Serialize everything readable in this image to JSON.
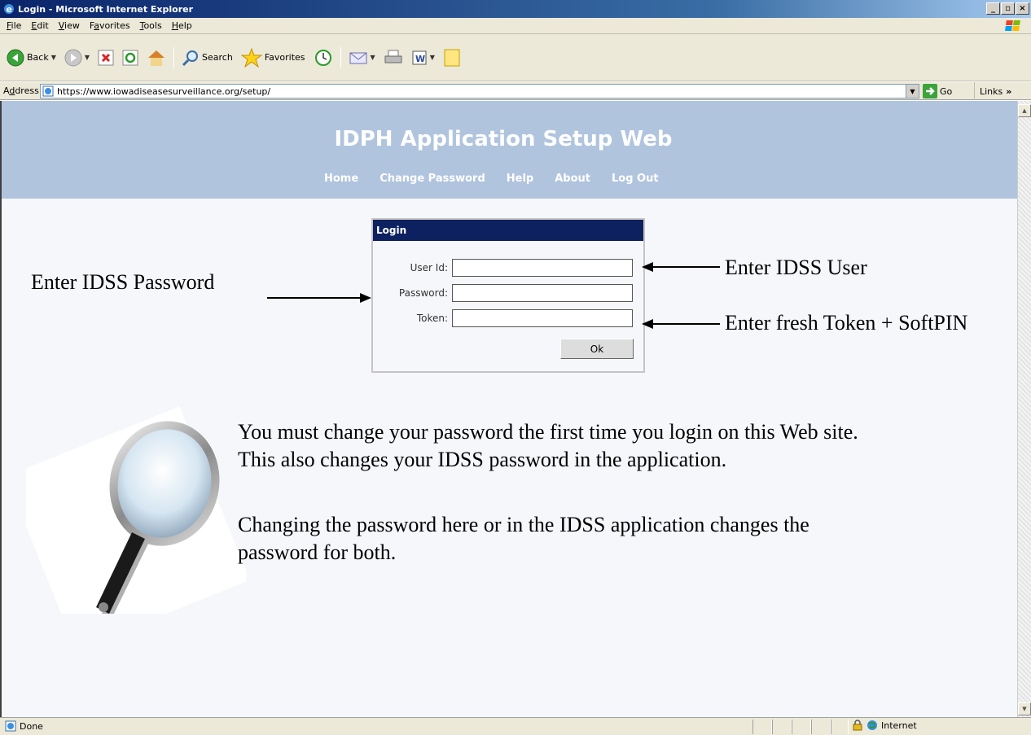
{
  "window": {
    "title": "Login - Microsoft Internet Explorer",
    "controls": [
      "_",
      "▫",
      "×"
    ]
  },
  "menu": [
    {
      "label": "File",
      "accel": "F",
      "rest": "ile"
    },
    {
      "label": "Edit",
      "accel": "E",
      "rest": "dit"
    },
    {
      "label": "View",
      "accel": "V",
      "rest": "iew"
    },
    {
      "label": "Favorites",
      "accel": "a",
      "pre": "F",
      "rest": "vorites"
    },
    {
      "label": "Tools",
      "accel": "T",
      "rest": "ools"
    },
    {
      "label": "Help",
      "accel": "H",
      "rest": "elp"
    }
  ],
  "toolbar": {
    "back_label": "Back",
    "search_label": "Search",
    "favorites_label": "Favorites"
  },
  "address": {
    "label": "Address",
    "accel": "d",
    "url": "https://www.iowadiseasesurveillance.org/setup/",
    "go_label": "Go",
    "links_label": "Links"
  },
  "site": {
    "title": "IDPH Application Setup Web",
    "nav": [
      "Home",
      "Change Password",
      "Help",
      "About",
      "Log Out"
    ]
  },
  "login": {
    "header": "Login",
    "user_label": "User Id:",
    "password_label": "Password:",
    "token_label": "Token:",
    "ok_label": "Ok"
  },
  "annotations": {
    "password_hint": "Enter IDSS Password",
    "user_hint": "Enter IDSS User",
    "token_hint": "Enter fresh Token + SoftPIN"
  },
  "body": {
    "paragraph1": "You must change your password the first time you login on this Web site. This also changes your IDSS password in the application.",
    "paragraph2": "Changing the password here or in the IDSS application changes the password for both."
  },
  "status": {
    "text": "Done",
    "zone": "Internet"
  },
  "colors": {
    "header_bg": "#b0c4de",
    "login_head_bg": "#0d2160",
    "page_bg": "#f5f7fb"
  }
}
